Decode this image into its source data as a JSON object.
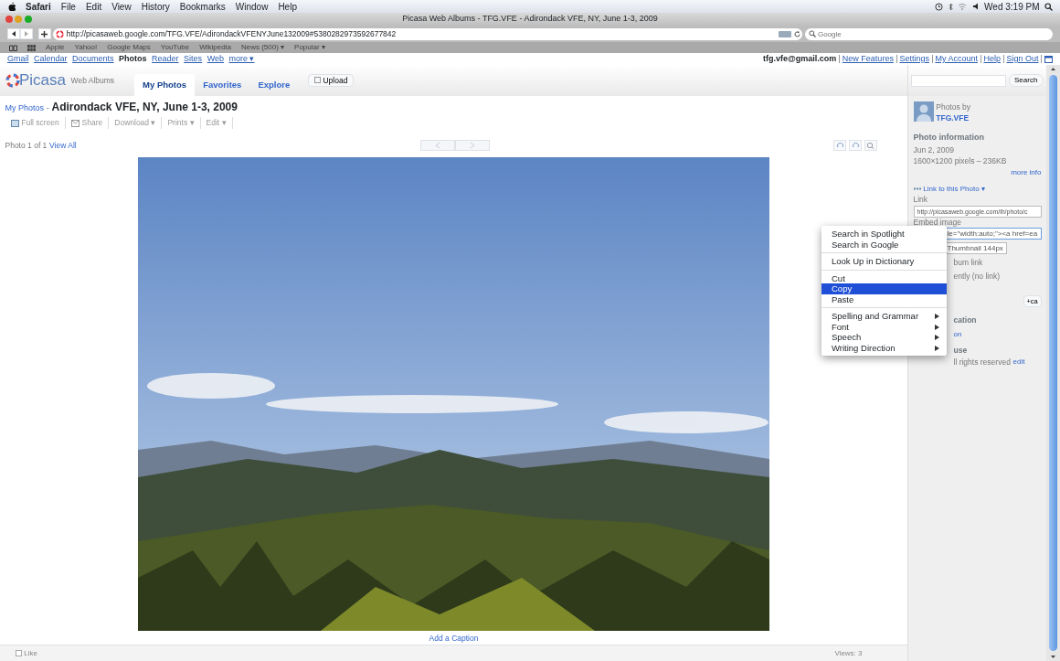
{
  "menubar": {
    "items": [
      "Safari",
      "File",
      "Edit",
      "View",
      "History",
      "Bookmarks",
      "Window",
      "Help"
    ],
    "clock": "Wed 3:19 PM"
  },
  "window": {
    "title": "Picasa Web Albums - TFG.VFE - Adirondack VFE, NY, June 1-3, 2009"
  },
  "address": "http://picasaweb.google.com/TFG.VFE/AdirondackVFENYJune132009#5380282973592677842",
  "search": {
    "placeholder": "Google"
  },
  "bookmarks": [
    "Apple",
    "Yahoo!",
    "Google Maps",
    "YouTube",
    "Wikipedia",
    "News (500) ▾",
    "Popular ▾"
  ],
  "google_bar": {
    "links": [
      {
        "label": "Gmail",
        "selected": false
      },
      {
        "label": "Calendar",
        "selected": false
      },
      {
        "label": "Documents",
        "selected": false
      },
      {
        "label": "Photos",
        "selected": true
      },
      {
        "label": "Reader",
        "selected": false
      },
      {
        "label": "Sites",
        "selected": false
      },
      {
        "label": "Web",
        "selected": false
      },
      {
        "label": "more ▾",
        "selected": false
      }
    ],
    "account": "tfg.vfe@gmail.com",
    "account_links": [
      "New Features",
      "Settings",
      "My Account",
      "Help",
      "Sign Out"
    ]
  },
  "picasa": {
    "logo": "Picasa",
    "subtitle": "Web Albums",
    "tabs": [
      {
        "label": "My Photos",
        "selected": true
      },
      {
        "label": "Favorites",
        "selected": false
      },
      {
        "label": "Explore",
        "selected": false
      }
    ],
    "upload": "Upload",
    "search_button": "Search"
  },
  "breadcrumb": "My Photos",
  "breadcrumb_separator": "-",
  "album_title": "Adirondack VFE, NY, June 1-3, 2009",
  "actions": [
    {
      "label": "Full screen",
      "kind": "icon"
    },
    {
      "label": "Share",
      "kind": "icon"
    },
    {
      "label": "Download ▾",
      "kind": "menu"
    },
    {
      "label": "Prints ▾",
      "kind": "menu"
    },
    {
      "label": "Edit ▾",
      "kind": "menu"
    }
  ],
  "photo_counter": "Photo 1 of 1",
  "view_all": "View All",
  "caption": "Add a Caption",
  "footer": {
    "like": "Like",
    "views": "Views: 3"
  },
  "sidebar": {
    "photos_by": "Photos by",
    "owner": "TFG.VFE",
    "info_heading": "Photo information",
    "date": "Jun 2, 2009",
    "size": "1600×1200 pixels – 236KB",
    "more_info": "more info",
    "link_menu": "Link to this Photo ▾",
    "link_label": "Link",
    "link_value": "http://picasaweb.google.com/lh/photo/c",
    "embed_label": "Embed image",
    "embed_value": "le=\"width:auto;\"><a href=ea",
    "size_select": "Thumbnail 144px",
    "album_link": "bum link",
    "image_only": "ently (no link)",
    "tag_button": "+ca",
    "location": "cation",
    "location_value": "on",
    "usage": "use",
    "rights": "ll rights reserved",
    "rights_edit": "edit"
  },
  "context_menu": {
    "groups": [
      [
        {
          "label": "Search in Spotlight",
          "selected": false,
          "submenu": false
        },
        {
          "label": "Search in Google",
          "selected": false,
          "submenu": false
        }
      ],
      [
        {
          "label": "Look Up in Dictionary",
          "selected": false,
          "submenu": false
        }
      ],
      [
        {
          "label": "Cut",
          "selected": false,
          "submenu": false
        },
        {
          "label": "Copy",
          "selected": true,
          "submenu": false
        },
        {
          "label": "Paste",
          "selected": false,
          "submenu": false
        }
      ],
      [
        {
          "label": "Spelling and Grammar",
          "selected": false,
          "submenu": true
        },
        {
          "label": "Font",
          "selected": false,
          "submenu": true
        },
        {
          "label": "Speech",
          "selected": false,
          "submenu": true
        },
        {
          "label": "Writing Direction",
          "selected": false,
          "submenu": true
        }
      ]
    ]
  }
}
